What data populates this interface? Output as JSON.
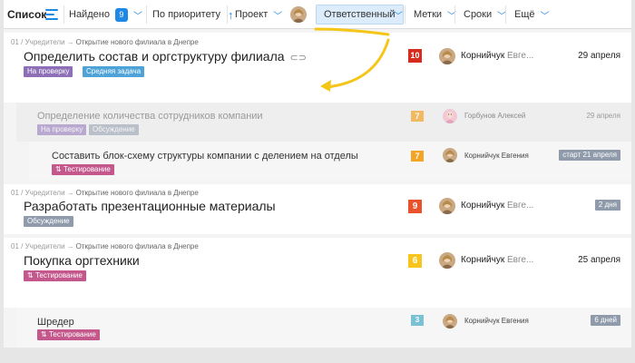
{
  "toolbar": {
    "view_label": "Список",
    "found_label": "Найдено",
    "found_count": "9",
    "sort_label": "По приоритету",
    "project_label": "Проект",
    "responsible_label": "Ответственный",
    "tags_label": "Метки",
    "deadlines_label": "Сроки",
    "more_label": "Ещё",
    "accent_color": "#1e88e5"
  },
  "tasks": [
    {
      "breadcrumb_root": "01 / Учредители",
      "breadcrumb_current": "Открытие нового филиала в Днепре",
      "title": "Определить состав и оргструктуру филиала",
      "tags": [
        "На проверку",
        "Средняя задача"
      ],
      "priority": "10",
      "person_name": "Корнийчук",
      "person_surname": "Евге...",
      "due": "29 апреля"
    },
    {
      "title": "Определение количества сотрудников компании",
      "tags": [
        "На проверку",
        "Обсуждение"
      ],
      "priority": "7",
      "person_name": "Горбунов Алексей",
      "due": "29 апреля"
    },
    {
      "title": "Составить блок-схему структуры компании с делением на отделы",
      "tags": [
        "Тестирование"
      ],
      "priority": "7",
      "person_name": "Корнийчук Евгения",
      "due": "старт 21 апреля"
    },
    {
      "breadcrumb_root": "01 / Учредители",
      "breadcrumb_current": "Открытие нового филиала в Днепре",
      "title": "Разработать презентационные материалы",
      "tags": [
        "Обсуждение"
      ],
      "priority": "9",
      "person_name": "Корнийчук",
      "person_surname": "Евге...",
      "due": "2 дня"
    },
    {
      "breadcrumb_root": "01 / Учредители",
      "breadcrumb_current": "Открытие нового филиала в Днепре",
      "title": "Покупка оргтехники",
      "tags": [
        "Тестирование"
      ],
      "priority": "6",
      "person_name": "Корнийчук",
      "person_surname": "Евге...",
      "due": "25 апреля"
    },
    {
      "title": "Шредер",
      "tags": [
        "Тестирование"
      ],
      "priority": "3",
      "person_name": "Корнийчук Евгения",
      "due": "6 дней"
    }
  ],
  "icons": {
    "menu": "list-menu-icon",
    "chevron": "chevron-down-icon",
    "sort": "arrow-up-icon",
    "clip": "paperclip-icon",
    "testing": "sort-arrows-icon"
  },
  "highlight_arrow_color": "#f5c518"
}
